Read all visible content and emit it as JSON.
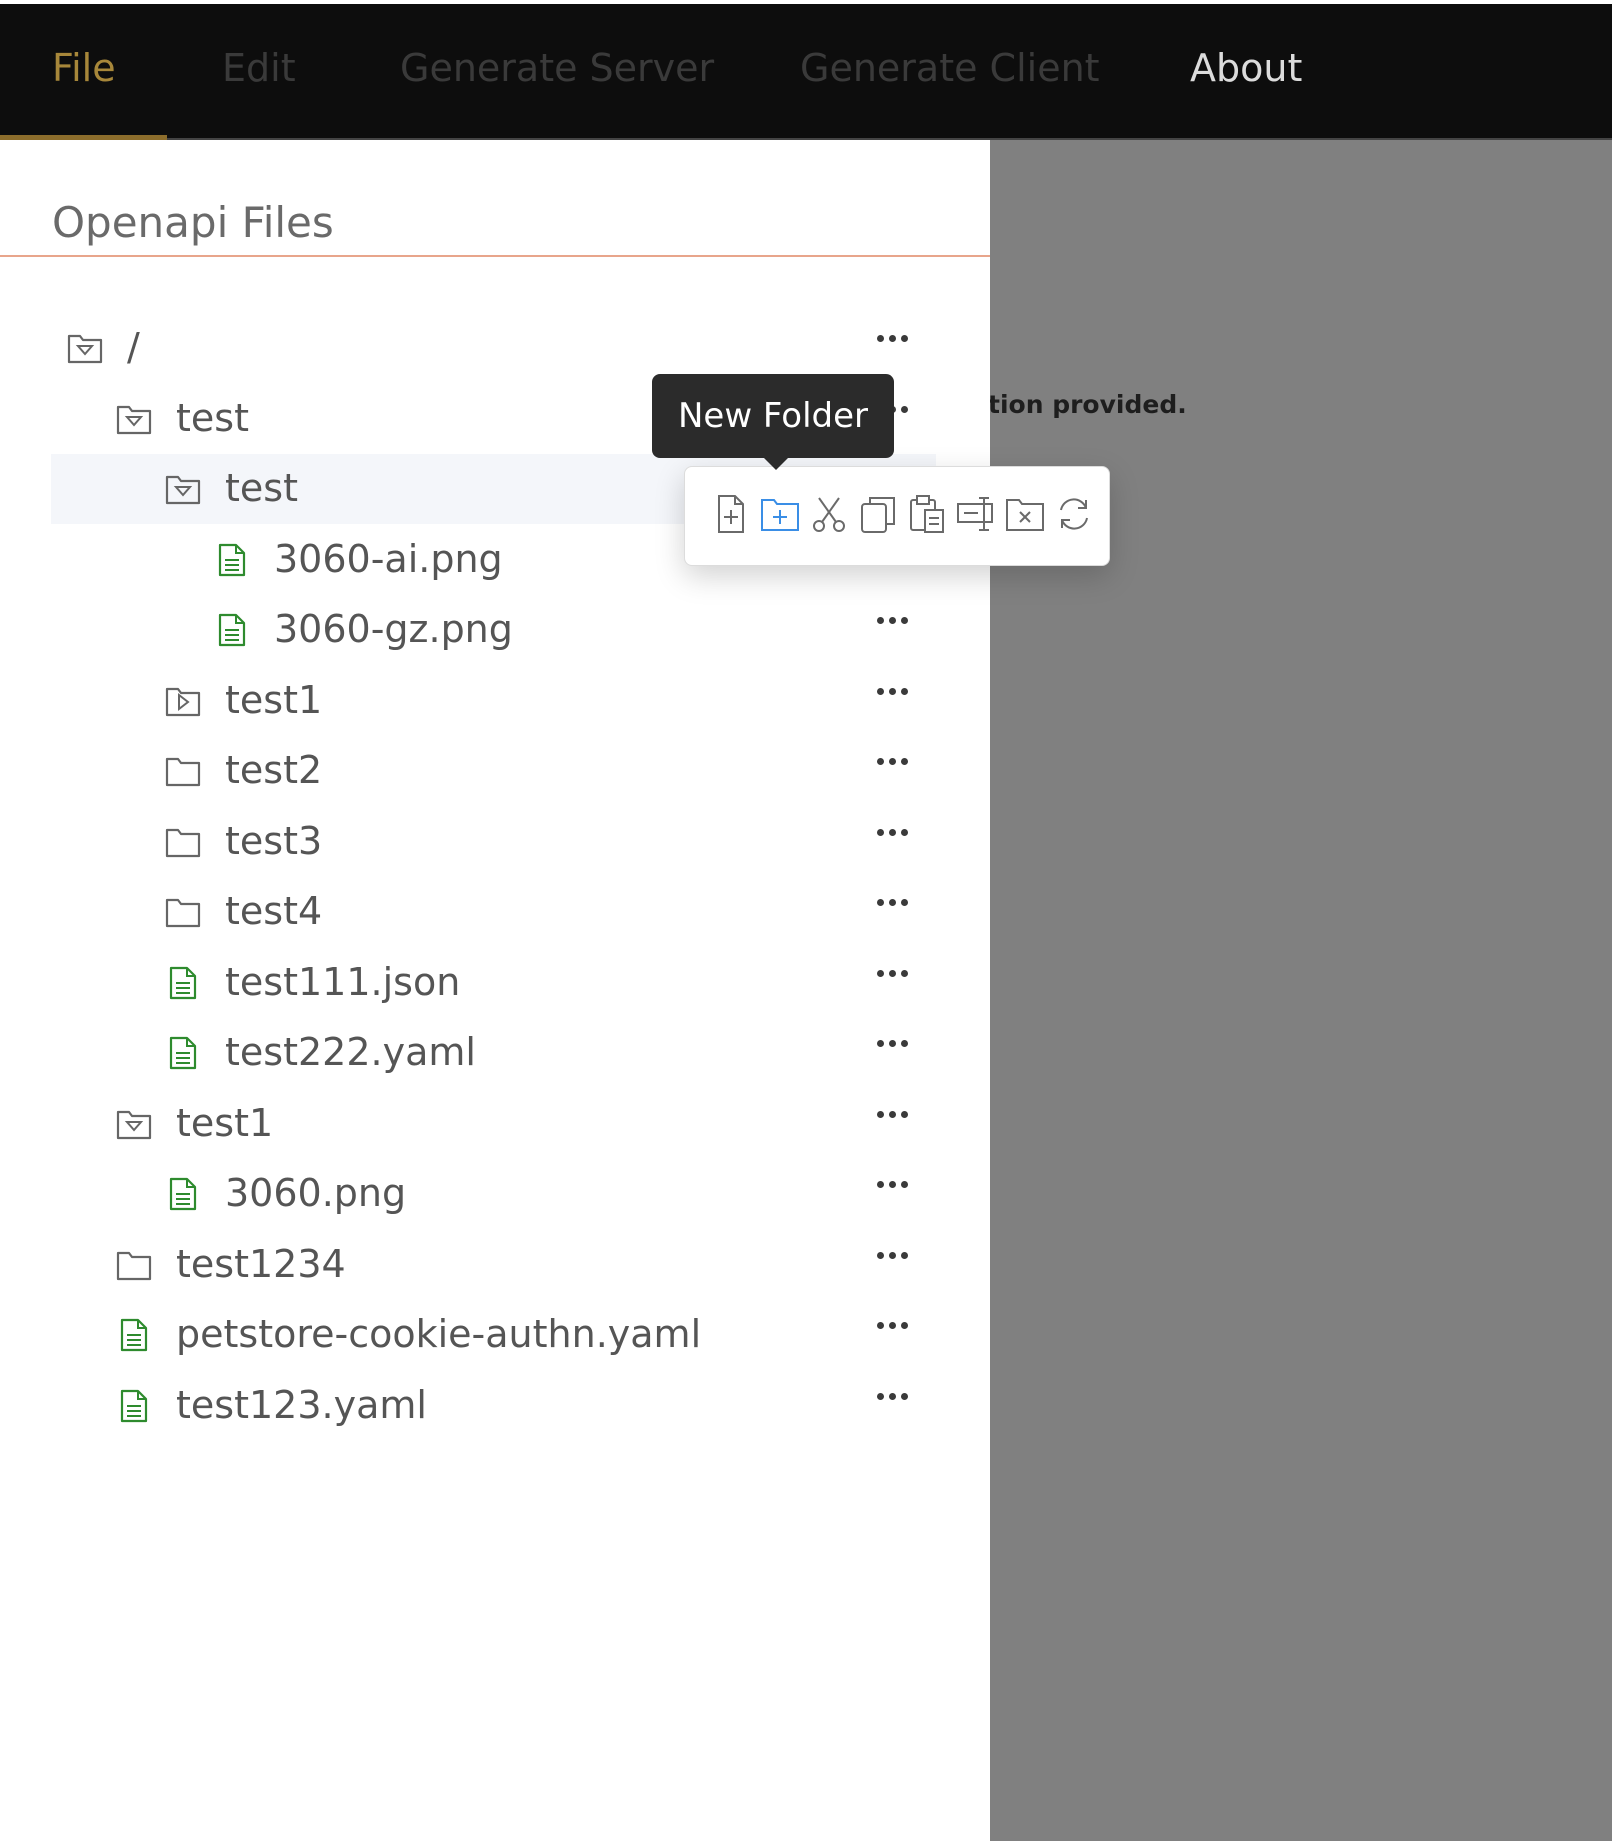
{
  "menubar": {
    "items": [
      {
        "label": "File",
        "state": "active"
      },
      {
        "label": "Edit",
        "state": "dim"
      },
      {
        "label": "Generate Server",
        "state": "dim"
      },
      {
        "label": "Generate Client",
        "state": "dim"
      },
      {
        "label": "About",
        "state": "bright"
      }
    ]
  },
  "background": {
    "text": "tion provided."
  },
  "drawer": {
    "title": "Openapi Files",
    "tree": [
      {
        "label": "/",
        "type": "folder-open",
        "depth": 0
      },
      {
        "label": "test",
        "type": "folder-open",
        "depth": 1
      },
      {
        "label": "test",
        "type": "folder-open",
        "depth": 2,
        "selected": true
      },
      {
        "label": "3060-ai.png",
        "type": "file",
        "depth": 3
      },
      {
        "label": "3060-gz.png",
        "type": "file",
        "depth": 3
      },
      {
        "label": "test1",
        "type": "folder-collapsed",
        "depth": 2
      },
      {
        "label": "test2",
        "type": "folder",
        "depth": 2
      },
      {
        "label": "test3",
        "type": "folder",
        "depth": 2
      },
      {
        "label": "test4",
        "type": "folder",
        "depth": 2
      },
      {
        "label": "test111.json",
        "type": "file",
        "depth": 2
      },
      {
        "label": "test222.yaml",
        "type": "file",
        "depth": 2
      },
      {
        "label": "test1",
        "type": "folder-open",
        "depth": 1
      },
      {
        "label": "3060.png",
        "type": "file",
        "depth": 2
      },
      {
        "label": "test1234",
        "type": "folder",
        "depth": 1
      },
      {
        "label": "petstore-cookie-authn.yaml",
        "type": "file",
        "depth": 1
      },
      {
        "label": "test123.yaml",
        "type": "file",
        "depth": 1
      }
    ]
  },
  "tooltip": {
    "text": "New Folder"
  },
  "popover": {
    "actions": [
      {
        "icon": "new-file-icon"
      },
      {
        "icon": "new-folder-icon",
        "highlighted": true
      },
      {
        "icon": "cut-icon"
      },
      {
        "icon": "copy-icon"
      },
      {
        "icon": "paste-icon"
      },
      {
        "icon": "rename-icon"
      },
      {
        "icon": "delete-icon"
      },
      {
        "icon": "refresh-icon"
      }
    ]
  },
  "colors": {
    "menubar_bg": "#0d0d0d",
    "active_menu": "#a7873a",
    "file_icon": "#2e8b2e",
    "folder_icon": "#666666",
    "highlight_icon": "#3a8ee6",
    "overlay": "#808080"
  }
}
